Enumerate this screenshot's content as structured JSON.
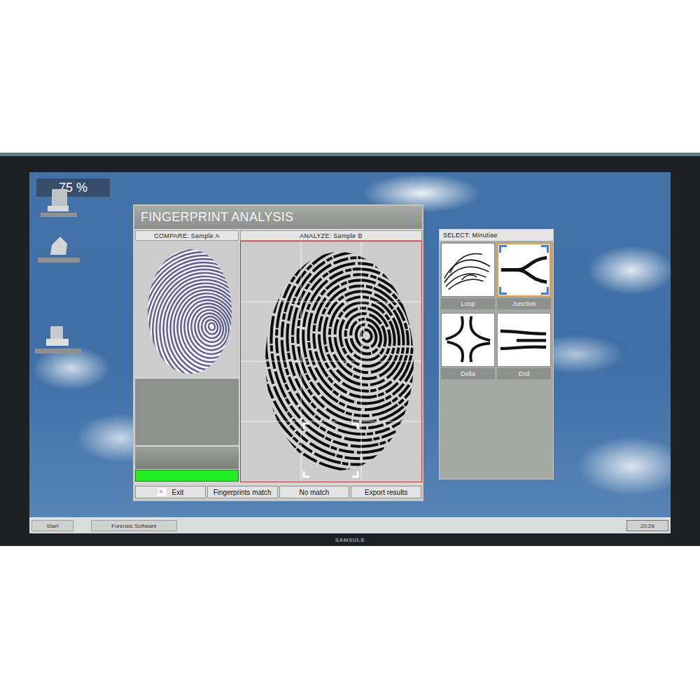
{
  "status_badge": {
    "text": "75 %"
  },
  "window": {
    "title": "FINGERPRINT ANALYSIS",
    "compare": {
      "header": "COMPARE: Sample A",
      "progress": {
        "level": 1
      }
    },
    "analyze": {
      "header": "ANALYZE: Sample B"
    },
    "buttons": [
      {
        "label": "Exit",
        "icon": "×"
      },
      {
        "label": "Fingerprints match",
        "icon": ""
      },
      {
        "label": "No match",
        "icon": ""
      },
      {
        "label": "Export results",
        "icon": ""
      }
    ]
  },
  "minutiae": {
    "title": "SELECT: Minutiae",
    "items": [
      {
        "label": "Loop",
        "selected": false
      },
      {
        "label": "Junction",
        "selected": true
      },
      {
        "label": "Delta",
        "selected": false
      },
      {
        "label": "End",
        "selected": false
      }
    ]
  },
  "taskbar": {
    "buttons": [
      "Start",
      "Forensic Software"
    ],
    "clock": "20:28"
  },
  "monitor": {
    "brand": "SAMSULE"
  }
}
